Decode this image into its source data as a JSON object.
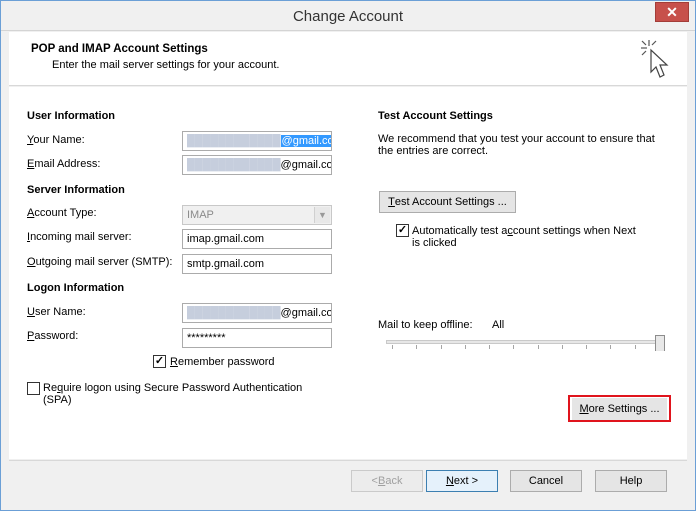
{
  "window": {
    "title": "Change Account",
    "close": "✕"
  },
  "header": {
    "title": "POP and IMAP Account Settings",
    "subtitle": "Enter the mail server settings for your account."
  },
  "user_info": {
    "heading": "User Information",
    "name_label": "Your Name:",
    "name_value_domain": "@gmail.com",
    "email_label": "Email Address:",
    "email_value_domain": "@gmail.com"
  },
  "server_info": {
    "heading": "Server Information",
    "account_type_label": "Account Type:",
    "account_type_value": "IMAP",
    "incoming_label": "Incoming mail server:",
    "incoming_value": "imap.gmail.com",
    "outgoing_label": "Outgoing mail server (SMTP):",
    "outgoing_value": "smtp.gmail.com"
  },
  "logon_info": {
    "heading": "Logon Information",
    "user_label": "User Name:",
    "user_value_domain": "@gmail.com",
    "password_label": "Password:",
    "password_value": "*********",
    "remember_label": "Remember password",
    "remember_checked": true,
    "spa_label_line1": "Require logon using Secure Password Authentication",
    "spa_label_line2": "(SPA)",
    "spa_checked": false
  },
  "test_settings": {
    "heading": "Test Account Settings",
    "desc_line1": "We recommend that you test your account to ensure that",
    "desc_line2": "the entries are correct.",
    "test_button": "Test Account Settings ...",
    "auto_test_line1": "Automatically test account settings when Next",
    "auto_test_line2": "is clicked",
    "auto_test_checked": true
  },
  "offline": {
    "label": "Mail to keep offline:",
    "value": "All",
    "level_fraction": 1.0
  },
  "more_settings_button": "More Settings ...",
  "footer": {
    "back": "< Back",
    "next": "Next >",
    "cancel": "Cancel",
    "help": "Help"
  },
  "colors": {
    "highlight": "#e0141d",
    "close_button": "#c7504b",
    "selection": "#3399ff"
  }
}
